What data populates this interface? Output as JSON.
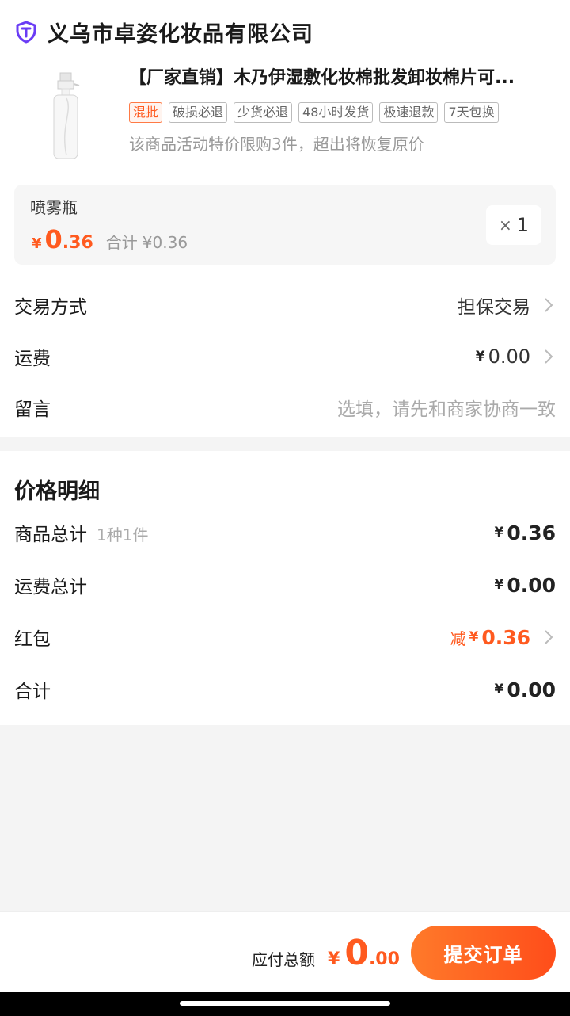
{
  "shop": {
    "icon": "shop-badge-icon",
    "name": "义乌市卓姿化妆品有限公司"
  },
  "product": {
    "image": "spray-bottle",
    "title": "【厂家直销】木乃伊湿敷化妆棉批发卸妆棉片可...",
    "tags": [
      "混批",
      "破损必退",
      "少货必退",
      "48小时发货",
      "极速退款",
      "7天包换"
    ],
    "limit_note": "该商品活动特价限购3件，超出将恢复原价"
  },
  "sku": {
    "name": "喷雾瓶",
    "yen": "¥",
    "price_int": "0",
    "price_dec": ".36",
    "sum_label": "合计",
    "sum_value": "¥0.36",
    "qty_x": "×",
    "qty": "1"
  },
  "options": {
    "trade_label": "交易方式",
    "trade_value": "担保交易",
    "freight_label": "运费",
    "freight_yen": "¥",
    "freight_value": "0.00",
    "message_label": "留言",
    "message_placeholder": "选填，请先和商家协商一致"
  },
  "price_detail": {
    "title": "价格明细",
    "goods_label": "商品总计",
    "goods_count": "1种1件",
    "goods_yen": "¥",
    "goods_value": "0.36",
    "freight_label": "运费总计",
    "freight_yen": "¥",
    "freight_value": "0.00",
    "redpacket_label": "红包",
    "redpacket_prefix": "减",
    "redpacket_yen": "¥",
    "redpacket_value": "0.36",
    "total_label": "合计",
    "total_yen": "¥",
    "total_value": "0.00"
  },
  "footer": {
    "pay_label": "应付总额",
    "pay_yen": "¥",
    "pay_int": "0",
    "pay_dec": ".00",
    "submit_label": "提交订单"
  },
  "colors": {
    "accent": "#ff5a1f",
    "background": "#f4f4f4"
  }
}
